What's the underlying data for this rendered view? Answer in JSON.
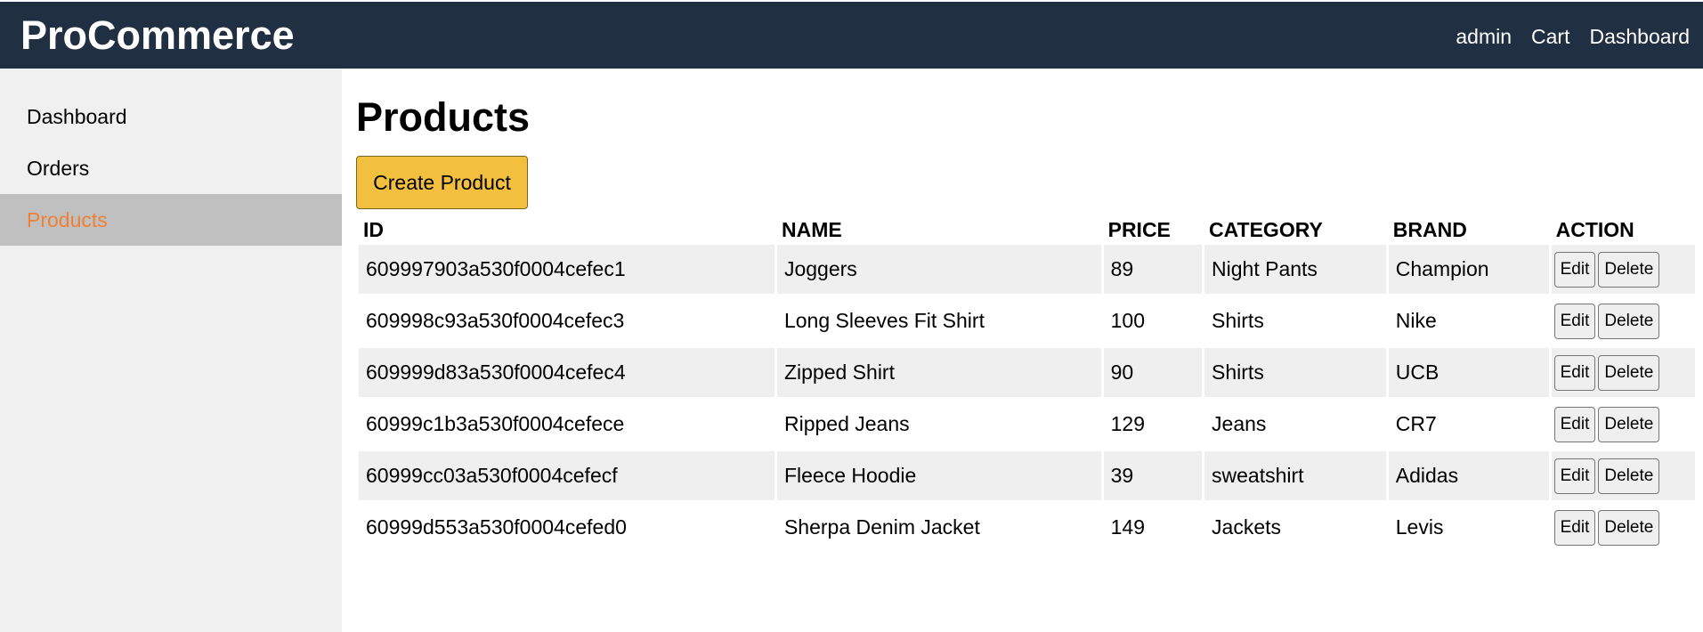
{
  "header": {
    "brand": "ProCommerce",
    "nav": [
      "admin",
      "Cart",
      "Dashboard"
    ]
  },
  "sidebar": {
    "items": [
      {
        "label": "Dashboard",
        "active": false
      },
      {
        "label": "Orders",
        "active": false
      },
      {
        "label": "Products",
        "active": true
      }
    ]
  },
  "main": {
    "title": "Products",
    "create_label": "Create Product"
  },
  "table": {
    "columns": [
      "ID",
      "NAME",
      "PRICE",
      "CATEGORY",
      "BRAND",
      "ACTION"
    ],
    "edit_label": "Edit",
    "delete_label": "Delete",
    "rows": [
      {
        "id": "609997903a530f0004cefec1",
        "name": "Joggers",
        "price": "89",
        "category": "Night Pants",
        "brand": "Champion"
      },
      {
        "id": "609998c93a530f0004cefec3",
        "name": "Long Sleeves Fit Shirt",
        "price": "100",
        "category": "Shirts",
        "brand": "Nike"
      },
      {
        "id": "609999d83a530f0004cefec4",
        "name": "Zipped Shirt",
        "price": "90",
        "category": "Shirts",
        "brand": "UCB"
      },
      {
        "id": "60999c1b3a530f0004cefece",
        "name": "Ripped Jeans",
        "price": "129",
        "category": "Jeans",
        "brand": "CR7"
      },
      {
        "id": "60999cc03a530f0004cefecf",
        "name": "Fleece Hoodie",
        "price": "39",
        "category": "sweatshirt",
        "brand": "Adidas"
      },
      {
        "id": "60999d553a530f0004cefed0",
        "name": "Sherpa Denim Jacket",
        "price": "149",
        "category": "Jackets",
        "brand": "Levis"
      }
    ]
  },
  "colors": {
    "header_bg": "#212f42",
    "sidebar_bg": "#f0f0f0",
    "sidebar_active_bg": "#c0c0c0",
    "sidebar_active_text": "#f08038",
    "create_button_bg": "#f2c03e",
    "row_stripe": "#efefef"
  }
}
